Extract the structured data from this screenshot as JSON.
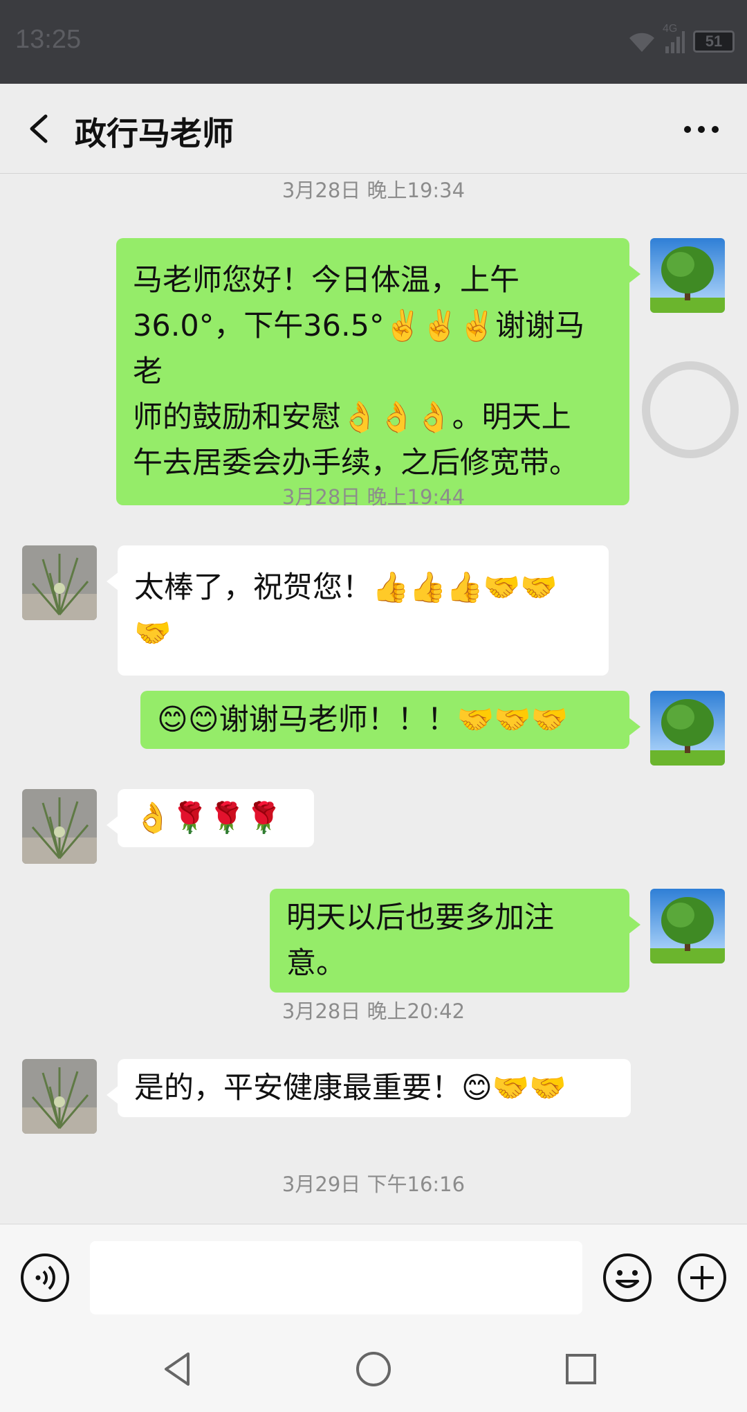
{
  "status_bar": {
    "time": "13:25",
    "network": "4G",
    "battery": "51",
    "icons": [
      "wifi-icon",
      "signal-icon",
      "battery-icon"
    ]
  },
  "header": {
    "title": "政行马老师",
    "back_icon": "chevron-left-icon",
    "more_icon": "more-dots-icon"
  },
  "messages": [
    {
      "type": "timestamp",
      "text": "3月28日 晚上19:34"
    },
    {
      "type": "me",
      "lines": [
        "马老师您好！今日体温，上午",
        "36.0°，下午36.5°✌️✌️✌️谢谢马老",
        "师的鼓励和安慰👌👌👌。明天上",
        "午去居委会办手续，之后修宽带。"
      ]
    },
    {
      "type": "timestamp",
      "text": "3月28日 晚上19:44"
    },
    {
      "type": "them",
      "lines": [
        "太棒了，祝贺您！👍👍👍🤝🤝",
        "🤝"
      ]
    },
    {
      "type": "me",
      "lines": [
        "😊😊谢谢马老师！！！🤝🤝🤝"
      ]
    },
    {
      "type": "them",
      "lines": [
        "👌🌹🌹🌹"
      ]
    },
    {
      "type": "me",
      "lines": [
        "明天以后也要多加注意。"
      ]
    },
    {
      "type": "timestamp",
      "text": "3月28日 晚上20:42"
    },
    {
      "type": "them",
      "lines": [
        "是的，平安健康最重要！😊🤝🤝"
      ]
    },
    {
      "type": "timestamp",
      "text": "3月29日 下午16:16"
    }
  ],
  "input_bar": {
    "placeholder": "",
    "icons": [
      "voice-icon",
      "emoji-icon",
      "plus-icon"
    ]
  },
  "nav_bar": {
    "icons": [
      "nav-back-icon",
      "nav-home-icon",
      "nav-recent-icon"
    ]
  },
  "colors": {
    "my_bubble": "#95ec69",
    "their_bubble": "#ffffff",
    "background": "#ededed",
    "status_bar": "#3b3c40"
  }
}
